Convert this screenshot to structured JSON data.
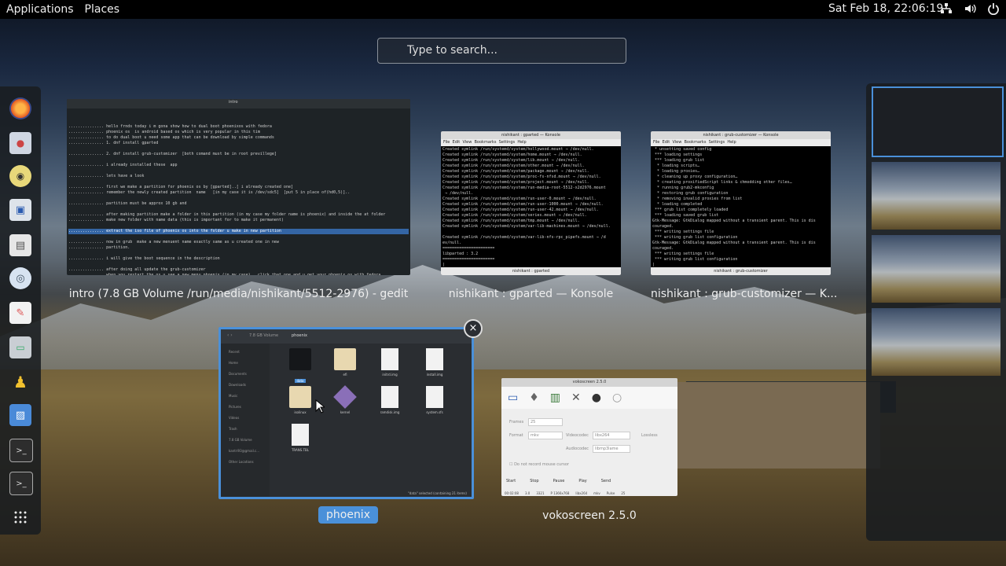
{
  "topbar": {
    "applications_label": "Applications",
    "places_label": "Places",
    "clock": "Sat Feb 18, 22:06:19"
  },
  "search": {
    "placeholder": "Type to search..."
  },
  "dash": {
    "apps": [
      {
        "name": "firefox-icon"
      },
      {
        "name": "software-icon"
      },
      {
        "name": "rhythmbox-icon"
      },
      {
        "name": "remote-desktop-icon"
      },
      {
        "name": "files-icon"
      },
      {
        "name": "screenshot-icon"
      },
      {
        "name": "text-editor-icon"
      },
      {
        "name": "drive-icon"
      },
      {
        "name": "tux-icon"
      },
      {
        "name": "kolourpaint-icon"
      },
      {
        "name": "terminal-icon"
      },
      {
        "name": "terminal-icon"
      },
      {
        "name": "show-apps-icon"
      }
    ]
  },
  "windows": {
    "gedit": {
      "caption": "intro (7.8 GB Volume /run/media/nishikant/5512-2976) - gedit",
      "title": "intro",
      "lines": [
        "............... hello frnds today i m gona show how to dual boot phoenixos with fedora",
        "............... phoenix os  is android based os which is very popular in this tim",
        "............... to do dual boot u need some app that can be download by simple commands",
        "............... 1. dnf install gparted",
        "",
        "............... 2. dnf install grub-customizer  [both comand must be in root previllege]",
        "",
        "............... i already installed these  app",
        "",
        "............... lets have a look",
        "",
        "............... first we make a partition for phoenix os by [gparted]..[ i already created one]",
        "............... remember the newly created partition  name   [in my case it is /dev/sdc5]  [put 5 in place of(hd0,5)]..",
        "",
        "............... partition must be approx 10 gb and",
        "",
        "............... after making partition make a folder in this partition (in my case my folder name is phoenix) and inside the at folder",
        "............... make new folder with name data (this is important for to make it permanent)",
        "",
        "............... extract the iso file of phoenix os into the folder u make in new partition",
        "",
        "............... now in grub  make a new menuent name exactly same as u created one in new",
        "............... partition.",
        "",
        "............... i will give the boot sequence in the description",
        "",
        "............... after doing all update the grub-customizer",
        "............... when you restart the os u see a new menu phoenix (in my case)   click that one and u get your phoenix os with fedora......"
      ]
    },
    "gparted_konsole": {
      "caption": "nishikant : gparted — Konsole",
      "title": "nishikant : gparted — Konsole",
      "menu": [
        "File",
        "Edit",
        "View",
        "Bookmarks",
        "Settings",
        "Help"
      ],
      "tab": "nishikant : gparted",
      "lines": [
        "Created symlink /run/systemd/system/hollywood.mount → /dev/null.",
        "Created symlink /run/systemd/system/home.mount → /dev/null.",
        "Created symlink /run/systemd/system/lib.mount → /dev/null.",
        "Created symlink /run/systemd/system/other.mount → /dev/null.",
        "Created symlink /run/systemd/system/package.mount → /dev/null.",
        "Created symlink /run/systemd/system/proc-fs-nfsd.mount → /dev/null.",
        "Created symlink /run/systemd/system/project.mount → /dev/null.",
        "Created symlink /run/systemd/system/run-media-root-5512-x2d2976.mount",
        " → /dev/null.",
        "Created symlink /run/systemd/system/run-user-0.mount → /dev/null.",
        "Created symlink /run/systemd/system/run-user-1000.mount → /dev/null.",
        "Created symlink /run/systemd/system/run-user-42.mount → /dev/null.",
        "Created symlink /run/systemd/system/series.mount → /dev/null.",
        "Created symlink /run/systemd/system/tmp.mount → /dev/null.",
        "Created symlink /run/systemd/system/var-lib-machines.mount → /dev/null.",
        "",
        "Created symlink /run/systemd/system/var-lib-nfs-rpc_pipefs.mount → /d",
        "ev/null.",
        "======================",
        "libparted : 3.2",
        "======================",
        "|"
      ]
    },
    "grub_konsole": {
      "caption": "nishikant : grub-customizer — K...",
      "title": "nishikant : grub-customizer — Konsole",
      "menu": [
        "File",
        "Edit",
        "View",
        "Bookmarks",
        "Settings",
        "Help"
      ],
      "tab": "nishikant : grub-customizer",
      "lines": [
        " * unsetting saved config",
        " *** loading settings",
        " *** loading grub list",
        "  * loading scripts…",
        "  * loading proxies…",
        "  * cleaning up proxy configuration…",
        "  * creating proxifiedScript links & chmodding other files…",
        "  * running grub2-mkconfig",
        "  * restoring grub configuration",
        "  * removing invalid proxies from list",
        "  * loading completed",
        " *** grub list completely loaded",
        " *** loading saved grub list",
        "Gtk-Message: GtkDialog mapped without a transient parent. This is dis",
        "couraged.",
        " *** writing settings file",
        " *** writing grub list configuration",
        "Gtk-Message: GtkDialog mapped without a transient parent. This is dis",
        "couraged.",
        " *** writing settings file",
        " *** writing grub list configuration",
        "|"
      ]
    },
    "phoenix": {
      "caption": "phoenix",
      "path_volume": "7.8 GB Volume",
      "path_folder": "phoenix",
      "sidebar": [
        "Recent",
        "Home",
        "Documents",
        "Downloads",
        "Music",
        "Pictures",
        "Videos",
        "Trash",
        "7.8 GB Volume",
        "kantri93@gmail.c...",
        "Other Locations"
      ],
      "files": [
        {
          "name": "data",
          "type": "folder-dark"
        },
        {
          "name": "efi",
          "type": "folder"
        },
        {
          "name": "initrd.img",
          "type": "file"
        },
        {
          "name": "install.img",
          "type": "file"
        },
        {
          "name": "isolinux",
          "type": "folder"
        },
        {
          "name": "kernel",
          "type": "diamond"
        },
        {
          "name": "ramdisk.img",
          "type": "file"
        },
        {
          "name": "system.sfs",
          "type": "file"
        },
        {
          "name": "TRANS.TBL",
          "type": "file"
        }
      ],
      "status": "\"data\" selected (containing 21 items)"
    },
    "vokoscreen": {
      "caption": "vokoscreen 2.5.0",
      "title": "vokoscreen 2.5.0",
      "frames_label": "Frames",
      "frames_value": "25",
      "format_label": "Format",
      "format_value": "mkv",
      "videocodec_label": "Videocodec",
      "videocodec_value": "libx264",
      "lossless_label": "Lossless",
      "audiocodec_label": "Audiocodec",
      "audiocodec_value": "libmp3lame",
      "mouse_label": "Do not record mouse cursor",
      "buttons": [
        "Start",
        "Stop",
        "Pause",
        "Play",
        "Send"
      ],
      "status": [
        "00:02:08",
        "3.0",
        "3321",
        "P 1366x768",
        "libx264",
        "mkv",
        "Pulse",
        "25"
      ]
    }
  }
}
